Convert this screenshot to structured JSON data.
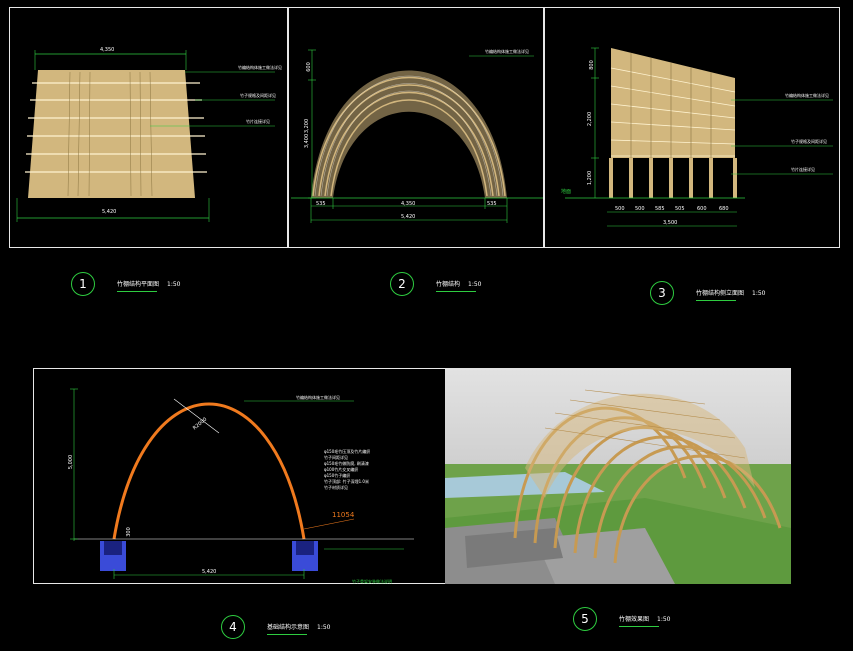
{
  "panels": {
    "p1": {
      "dims": {
        "top": "4,350",
        "bottom": "5,420"
      },
      "notes": [
        "竹编结构体施工做法详见",
        "竹子规格及间距详见",
        "竹片连接详见"
      ]
    },
    "p2": {
      "dims": {
        "h1": "600",
        "h2": "3,200",
        "h3": "3,400",
        "left": "535",
        "mid": "4,350",
        "right": "535",
        "total": "5,420"
      },
      "notes": [
        "竹编结构体施工做法详见"
      ]
    },
    "p3": {
      "dims": {
        "h1": "800",
        "h2": "2,200",
        "h3": "1,200",
        "ground": "地面",
        "s1": "500",
        "s2": "500",
        "s3": "585",
        "s4": "505",
        "s5": "600",
        "s6": "680",
        "total": "3,500"
      },
      "notes": [
        "竹编结构体施工做法详见",
        "竹子规格及间距详见",
        "竹片连接详见"
      ]
    },
    "p4": {
      "dims": {
        "height": "5,000",
        "radius": "R2000",
        "base": "300",
        "width": "5,420",
        "arc": "11054"
      },
      "notes": [
        "竹编结构体施工做法详见",
        "φ150毛竹压顶及竹片编织",
        "竹子间距详见",
        "φ150毛竹做防腐, 刷清漆",
        "φ100竹片交叉编织",
        "φ150竹子编织",
        "竹子顶部: 竹子深埋1.0米",
        "竹子材质详见"
      ],
      "footer_note": "竹子骨架安装做法说明"
    }
  },
  "captions": [
    {
      "number": "1",
      "title": "竹棚结构平面图",
      "scale": "1:50"
    },
    {
      "number": "2",
      "title": "竹棚结构",
      "scale": "1:50"
    },
    {
      "number": "3",
      "title": "竹棚结构侧立面图",
      "scale": "1:50"
    },
    {
      "number": "4",
      "title": "基础结构示意图",
      "scale": "1:50"
    },
    {
      "number": "5",
      "title": "竹棚效果图",
      "scale": "1:50"
    }
  ],
  "colors": {
    "bamboo": "#d2b77e",
    "bamboo_dark": "#a88f55",
    "dim_line": "#2ecc40",
    "arch_orange": "#f07a1e",
    "leader": "#2ecc40",
    "base_blue": "#3a4bd8"
  }
}
